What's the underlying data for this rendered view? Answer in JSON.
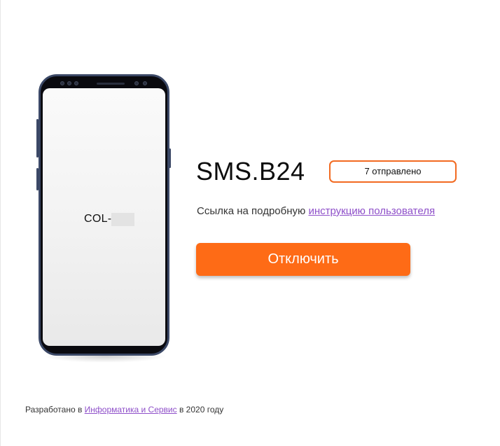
{
  "phone": {
    "screen_text": "COL-",
    "icons": [
      "camera-icon",
      "speaker-icon"
    ]
  },
  "app": {
    "title": "SMS.B24",
    "sent_badge": "7 отправлено",
    "info_prefix": "Ссылка на подробную ",
    "info_link": "инструкцию пользователя",
    "disable_button": "Отключить"
  },
  "footer": {
    "prefix": "Разработано в ",
    "link": "Информатика и Сервис",
    "suffix": " в 2020 году"
  },
  "colors": {
    "accent": "#fe6b16",
    "badge_border": "#f26a21",
    "link": "#8e4fc9",
    "phone_frame": "#3b4866"
  }
}
